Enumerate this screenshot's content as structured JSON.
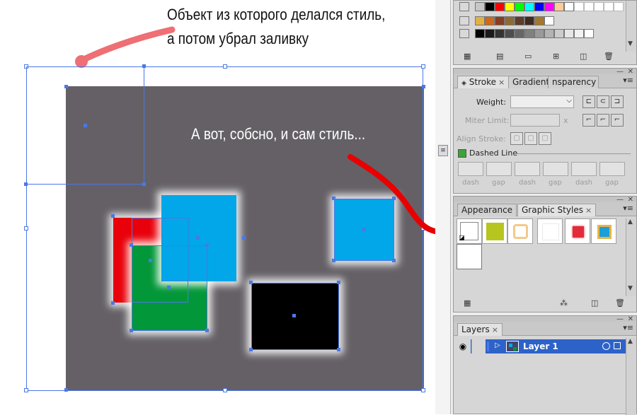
{
  "annotations": {
    "top_line1": "Объект из которого делался стиль,",
    "top_line2": "а потом убрал заливку",
    "middle": "А вот, собсно, и сам стиль..."
  },
  "colors": {
    "artboard": "#646066",
    "selection": "#4a78e6",
    "red_square": "#e8000a",
    "green_square": "#029738",
    "blue_square": "#01a7e8",
    "black_square": "#000000",
    "marker_pink": "#ee6f74",
    "marker_red": "#e80000",
    "layer_highlight": "#2d62c8"
  },
  "swatches": {
    "row1": [
      "#c7c7c7",
      "#000000",
      "#ff0000",
      "#ffff00",
      "#00ff00",
      "#00ffff",
      "#0000ff",
      "#ff00ff",
      "#ffcc99",
      "#ffffff",
      "#ffffff",
      "#ffffff",
      "#ffffff",
      "#ffffff",
      "#ffffff"
    ],
    "row2": [
      "#e3b042",
      "#cc6a1b",
      "#8a3c21",
      "#8e6a33",
      "#5e3b2b",
      "#3f2a20",
      "#a4772c",
      "#ffffff"
    ],
    "row3": [
      "#000000",
      "#1a1a1a",
      "#333333",
      "#4d4d4d",
      "#666666",
      "#808080",
      "#999999",
      "#b3b3b3",
      "#cccccc",
      "#e6e6e6",
      "#f2f2f2",
      "#ffffff"
    ]
  },
  "stroke_panel": {
    "tabs": [
      "Stroke",
      "Gradient",
      "nsparency"
    ],
    "weight_label": "Weight:",
    "miter_label": "Miter Limit:",
    "miter_x": "x",
    "align_label": "Align Stroke:",
    "dashed_label": "Dashed Line",
    "dash_labels": [
      "dash",
      "gap",
      "dash",
      "gap",
      "dash",
      "gap"
    ]
  },
  "styles_panel": {
    "tabs": [
      "Appearance",
      "Graphic Styles"
    ],
    "styles": [
      "default",
      "olive-green",
      "orange-outline",
      "white-glow",
      "red-fill",
      "blue-fill-orange-stroke",
      "new-style"
    ]
  },
  "layers_panel": {
    "tab": "Layers",
    "layer_name": "Layer 1"
  },
  "close_glyph": "×"
}
